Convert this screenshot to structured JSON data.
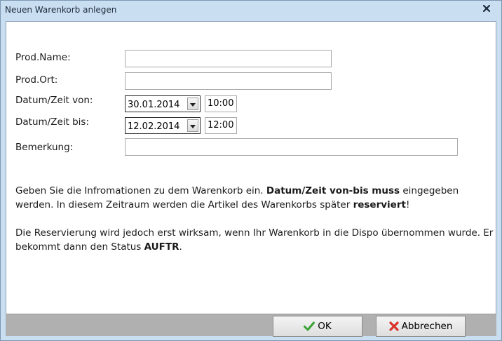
{
  "window": {
    "title": "Neuen Warenkorb anlegen"
  },
  "form": {
    "prod_name": {
      "label": "Prod.Name:",
      "value": ""
    },
    "prod_ort": {
      "label": "Prod.Ort:",
      "value": ""
    },
    "datum_von": {
      "label": "Datum/Zeit von:",
      "date": "30.01.2014",
      "time": "10:00"
    },
    "datum_bis": {
      "label": "Datum/Zeit bis:",
      "date": "12.02.2014",
      "time": "12:00"
    },
    "bemerkung": {
      "label": "Bemerkung:",
      "value": ""
    }
  },
  "info": {
    "p1_a": "Geben Sie die Infromationen zu dem Warenkorb ein. ",
    "p1_b": "Datum/Zeit von-bis muss",
    "p1_c": " eingegeben werden. In diesem Zeitraum werden die Artikel des Warenkorbs später ",
    "p1_d": "reserviert",
    "p1_e": "!",
    "p2_a": "Die Reservierung wird jedoch erst wirksam, wenn Ihr Warenkorb in die Dispo übernommen wurde. Er bekommt dann den Status ",
    "p2_b": "AUFTR",
    "p2_c": "."
  },
  "buttons": {
    "ok": "OK",
    "cancel": "Abbrechen"
  },
  "colors": {
    "titlebar": "#c9dff1",
    "ok_check": "#3aa235",
    "cancel_x": "#d9322b",
    "footer": "#b0b0b0"
  }
}
